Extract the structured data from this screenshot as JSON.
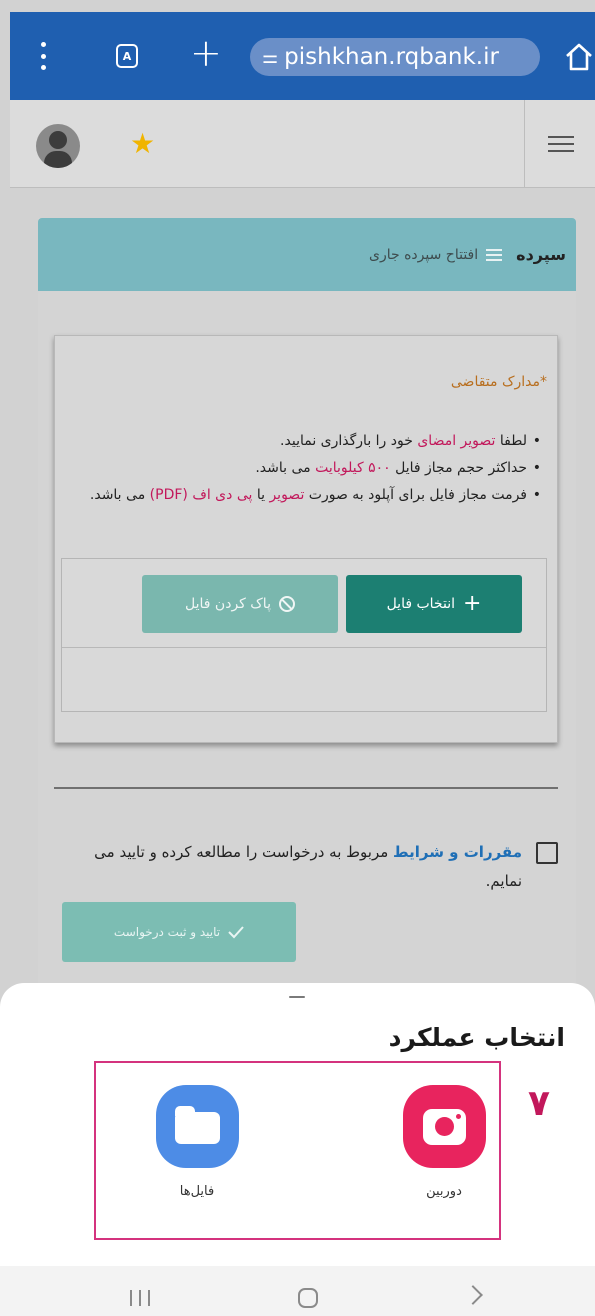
{
  "browser": {
    "tabs_count": "A",
    "url": "pishkhan.rqbank.ir"
  },
  "panel": {
    "title": "سپرده",
    "subtitle": "افتتاح سپرده جاری"
  },
  "documents": {
    "heading": "*مدارک متقاضی",
    "rule1_a": "لطفا ",
    "rule1_hl": "تصویر امضای",
    "rule1_b": " خود را بارگذاری نمایید.",
    "rule2_a": "حداکثر حجم مجاز فایل ",
    "rule2_hl": "۵۰۰ کیلوبایت",
    "rule2_b": " می باشد.",
    "rule3_a": "فرمت مجاز فایل برای آپلود به صورت ",
    "rule3_hl1": "تصویر",
    "rule3_b": " یا ",
    "rule3_hl2": "پی دی اف (PDF)",
    "rule3_c": " می باشد.",
    "select_file_label": "انتخاب فایل",
    "clear_file_label": "پاک کردن فایل"
  },
  "terms": {
    "link": "مقررات و شرایط",
    "text": " مربوط به درخواست را مطالعه کرده و تایید می نمایم.",
    "submit_label": "تایید و ثبت درخواست"
  },
  "sheet": {
    "title": "انتخاب عملکرد",
    "step_number": "۷",
    "apps": [
      {
        "label": "دوربین",
        "icon": "camera-icon",
        "color": "#e8245e"
      },
      {
        "label": "فایل‌ها",
        "icon": "folder-icon",
        "color": "#4d8ce6"
      }
    ]
  },
  "colors": {
    "browser_bar": "#1f5fb0",
    "panel_header": "#79b7bf",
    "primary_button": "#1c7f72",
    "highlight": "#c2185b",
    "link": "#1f6fb6"
  }
}
